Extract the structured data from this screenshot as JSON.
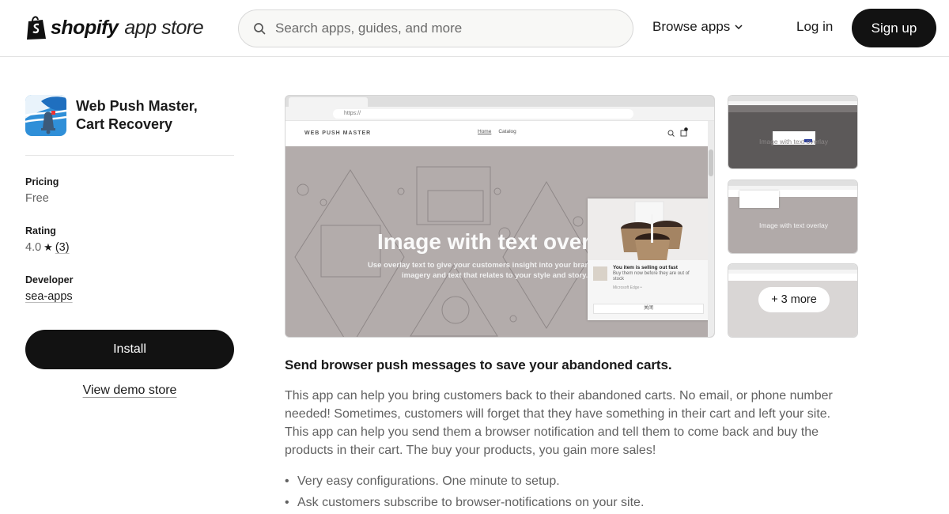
{
  "header": {
    "logo_brand": "shopify",
    "logo_suffix": "app store",
    "search_placeholder": "Search apps, guides, and more",
    "browse_label": "Browse apps",
    "login_label": "Log in",
    "signup_label": "Sign up"
  },
  "app": {
    "name_line1": "Web Push Master,",
    "name_line2": "Cart Recovery",
    "pricing_label": "Pricing",
    "pricing_value": "Free",
    "rating_label": "Rating",
    "rating_value": "4.0",
    "rating_star": "★",
    "rating_count": "(3)",
    "developer_label": "Developer",
    "developer_value": "sea-apps",
    "install_label": "Install",
    "demo_label": "View demo store"
  },
  "screenshot": {
    "address": "https://",
    "site_logo": "WEB PUSH MASTER",
    "nav_home": "Home",
    "nav_catalog": "Catalog",
    "hero_title": "Image with text overlay",
    "hero_sub1": "Use overlay text to give your customers insight into your brand. Select",
    "hero_sub2": "imagery and text that relates to your style and story.",
    "notif_title": "You item is selling out fast",
    "notif_text": "Buy them now before they are out of stock",
    "notif_source": "Microsoft Edge •",
    "notif_button": "关闭"
  },
  "thumbnails": {
    "t1_title": "Image with text overlay",
    "t2_title": "Image with text overlay",
    "more_label": "+ 3 more"
  },
  "description": {
    "heading": "Send browser push messages to save your abandoned carts.",
    "body": "This app can help you bring customers back to their abandoned carts. No email, or phone number needed! Sometimes, customers will forget that they have something in their cart and left your site. This app can help you send them a browser notification and tell them to come back and buy the products in their cart. The buy your products, you gain more sales!",
    "bullets": [
      "Very easy configurations. One minute to setup.",
      "Ask customers subscribe to browser-notifications on your site."
    ]
  }
}
